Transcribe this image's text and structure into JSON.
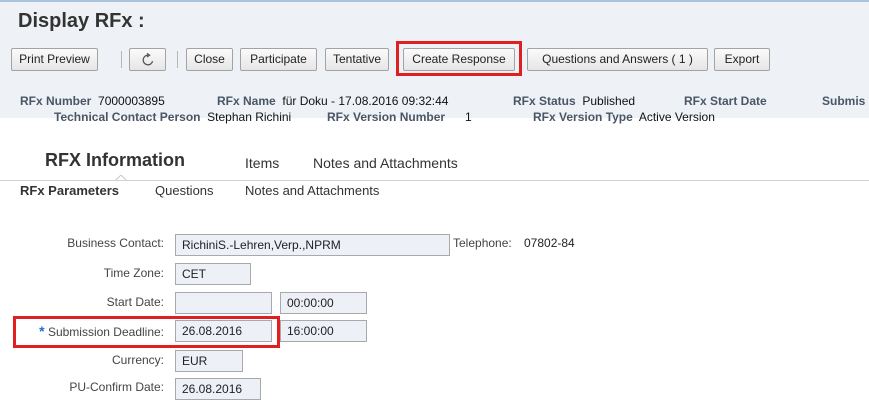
{
  "title": "Display RFx :",
  "toolbar": {
    "print_preview": "Print Preview",
    "close": "Close",
    "participate": "Participate",
    "tentative": "Tentative",
    "create_response": "Create Response",
    "questions_answers": "Questions and Answers ( 1 )",
    "export": "Export"
  },
  "header": {
    "rfx_number_label": "RFx Number",
    "rfx_number": "7000003895",
    "rfx_name_label": "RFx Name",
    "rfx_name": "für Doku - 17.08.2016 09:32:44",
    "rfx_status_label": "RFx Status",
    "rfx_status": "Published",
    "rfx_start_date_label": "RFx Start Date",
    "submis_label": "Submis",
    "tech_contact_label": "Technical Contact Person",
    "tech_contact": "Stephan Richini",
    "version_number_label": "RFx Version Number",
    "version_number": "1",
    "version_type_label": "RFx Version Type",
    "version_type": "Active Version"
  },
  "tabs": {
    "main": "RFX Information",
    "items": "Items",
    "notes": "Notes and Attachments"
  },
  "subtabs": {
    "parameters": "RFx Parameters",
    "questions": "Questions",
    "notes": "Notes and Attachments"
  },
  "form": {
    "business_contact_label": "Business Contact:",
    "business_contact": "RichiniS.-Lehren,Verp.,NPRM",
    "telephone_label": "Telephone:",
    "telephone": "07802-84",
    "time_zone_label": "Time Zone:",
    "time_zone": "CET",
    "start_date_label": "Start Date:",
    "start_date": "",
    "start_time": "00:00:00",
    "required_marker": "*",
    "deadline_label": "Submission Deadline:",
    "deadline_date": "26.08.2016",
    "deadline_time": "16:00:00",
    "currency_label": "Currency:",
    "currency": "EUR",
    "pu_confirm_label": "PU-Confirm Date:",
    "pu_confirm": "26.08.2016"
  }
}
